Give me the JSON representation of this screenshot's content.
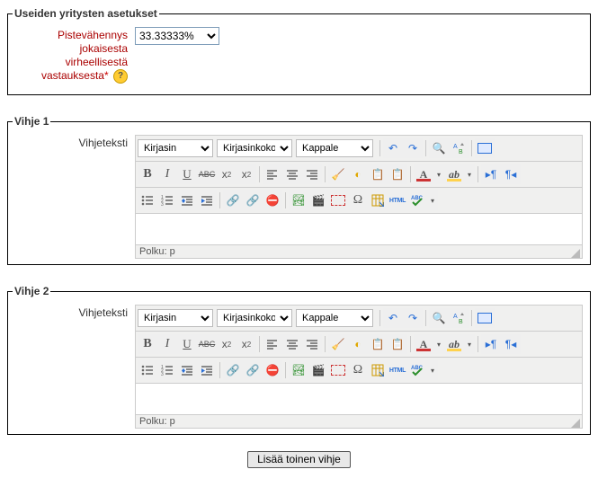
{
  "settings": {
    "legend": "Useiden yritysten asetukset",
    "penalty_label_l1": "Pistevähennys",
    "penalty_label_l2": "jokaisesta",
    "penalty_label_l3": "virheellisestä",
    "penalty_label_l4": "vastauksesta",
    "penalty_value": "33.33333%"
  },
  "hint1": {
    "legend": "Vihje 1",
    "label": "Vihjeteksti",
    "font_family": "Kirjasin",
    "font_size": "Kirjasinkoko",
    "paragraph": "Kappale",
    "path_prefix": "Polku:",
    "path_value": "p"
  },
  "hint2": {
    "legend": "Vihje 2",
    "label": "Vihjeteksti",
    "font_family": "Kirjasin",
    "font_size": "Kirjasinkoko",
    "paragraph": "Kappale",
    "path_prefix": "Polku:",
    "path_value": "p"
  },
  "add_button": "Lisää toinen vihje",
  "icons": {
    "bold": "B",
    "italic": "I",
    "underline": "U",
    "strike": "ABC",
    "sub": "x",
    "sup": "x",
    "undo_sym": "↶",
    "redo_sym": "↷",
    "find_sym": "🔍",
    "fullscreen_sym": "▭",
    "eraser": "◐",
    "paste_text": "📋",
    "paste_word": "📋",
    "a_glyph": "A",
    "link_sym": "⧉",
    "unlink_sym": "⧉̸",
    "anchor_sym": "⚓",
    "image_sym": "🏞",
    "media_sym": "▣",
    "table_sym": "☷",
    "omega_sym": "Ω",
    "edit_sym": "✎",
    "html_txt": "HTML",
    "paragraph_sym": "¶"
  }
}
